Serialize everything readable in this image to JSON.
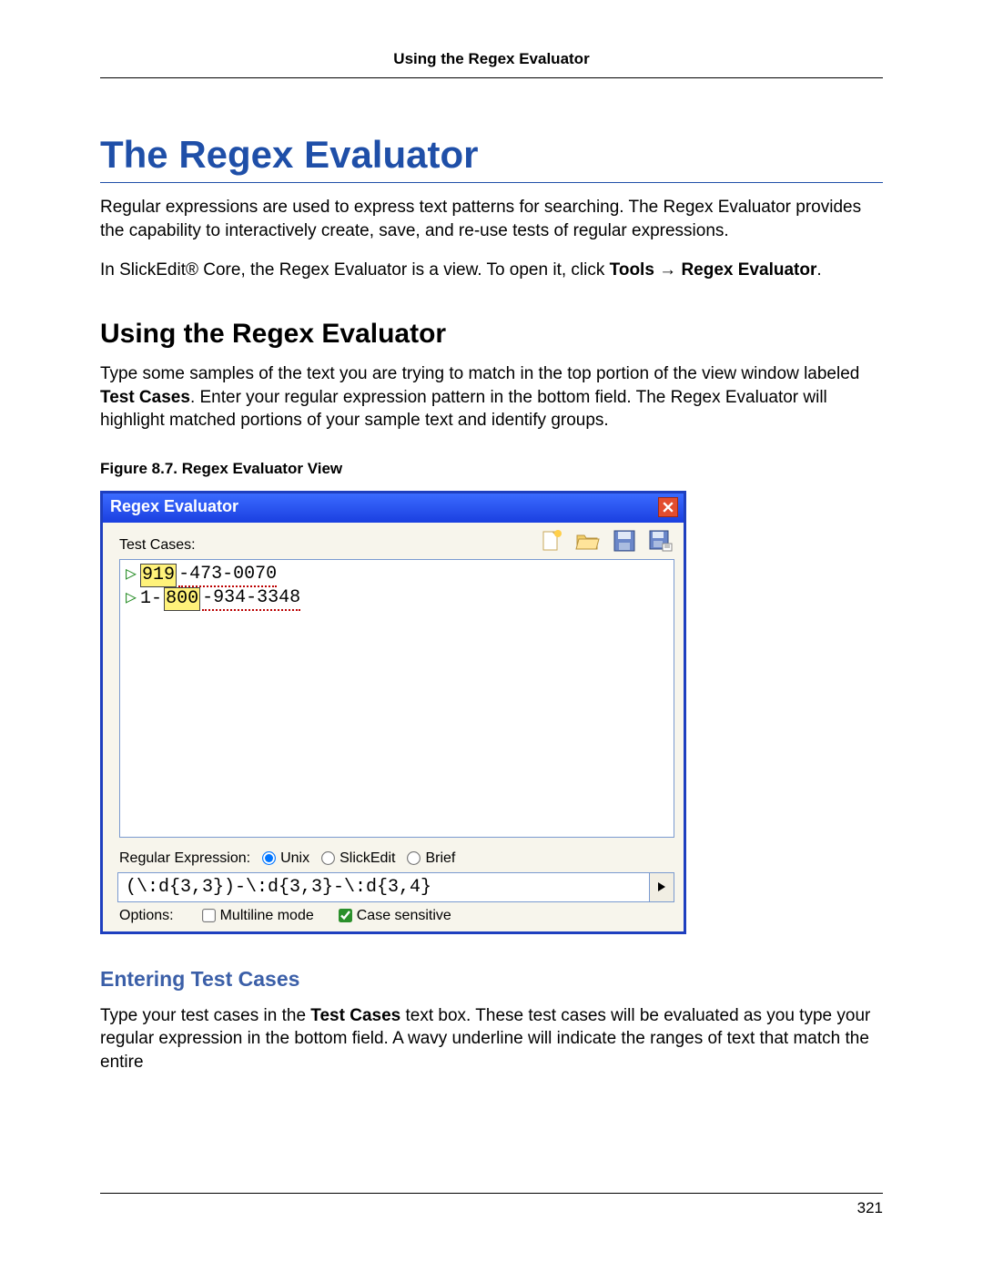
{
  "running_head": "Using the Regex Evaluator",
  "title": "The Regex Evaluator",
  "intro_p1": "Regular expressions are used to express text patterns for searching. The Regex Evaluator provides the capability to interactively create, save, and re-use tests of regular expressions.",
  "intro_p2_a": "In SlickEdit® Core, the Regex Evaluator is a view. To open it, click ",
  "intro_p2_b": "Tools → Regex Evaluator",
  "intro_p2_c": ".",
  "section_heading": "Using the Regex Evaluator",
  "sect_p1_a": "Type some samples of the text you are trying to match in the top portion of the view window labeled ",
  "sect_p1_b": "Test Cases",
  "sect_p1_c": ". Enter your regular expression pattern in the bottom field. The Regex Evaluator will highlight matched portions of your sample text and identify groups.",
  "figure_caption": "Figure 8.7. Regex Evaluator View",
  "panel": {
    "title": "Regex Evaluator",
    "test_cases_label": "Test Cases:",
    "lines": [
      {
        "group": "919",
        "rest": "-473-0070"
      },
      {
        "pre": "1-",
        "group": "800",
        "rest": "-934-3348"
      }
    ],
    "re_label": "Regular Expression:",
    "syntax": {
      "unix": "Unix",
      "slickedit": "SlickEdit",
      "brief": "Brief",
      "selected": "unix"
    },
    "re_value": "(\\:d{3,3})-\\:d{3,3}-\\:d{3,4}",
    "options_label": "Options:",
    "opt_multiline": "Multiline mode",
    "opt_case": "Case sensitive",
    "multiline_checked": false,
    "case_checked": true
  },
  "sub_heading": "Entering Test Cases",
  "sub_p_a": "Type your test cases in the ",
  "sub_p_b": "Test Cases",
  "sub_p_c": " text box. These test cases will be evaluated as you type your regular expression in the bottom field. A wavy underline will indicate the ranges of text that match the entire",
  "page_number": "321"
}
